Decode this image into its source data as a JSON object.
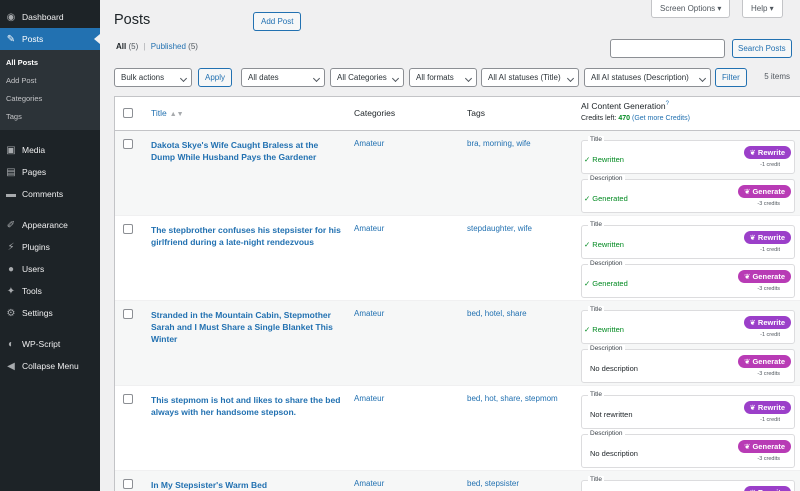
{
  "sidebar": {
    "items": [
      {
        "key": "dashboard",
        "label": "Dashboard",
        "icon": "dashboard-icon",
        "glyph": "◉"
      },
      {
        "key": "posts",
        "label": "Posts",
        "icon": "pin-icon",
        "glyph": "✎",
        "current": true
      },
      {
        "key": "media",
        "label": "Media",
        "icon": "media-icon",
        "glyph": "▣"
      },
      {
        "key": "pages",
        "label": "Pages",
        "icon": "pages-icon",
        "glyph": "▤"
      },
      {
        "key": "comments",
        "label": "Comments",
        "icon": "comment-icon",
        "glyph": "▬"
      },
      {
        "key": "appearance",
        "label": "Appearance",
        "icon": "brush-icon",
        "glyph": "✐"
      },
      {
        "key": "plugins",
        "label": "Plugins",
        "icon": "plug-icon",
        "glyph": "⚡"
      },
      {
        "key": "users",
        "label": "Users",
        "icon": "user-icon",
        "glyph": "●"
      },
      {
        "key": "tools",
        "label": "Tools",
        "icon": "wrench-icon",
        "glyph": "✦"
      },
      {
        "key": "settings",
        "label": "Settings",
        "icon": "settings-icon",
        "glyph": "⚙"
      },
      {
        "key": "wpscript",
        "label": "WP-Script",
        "icon": "wpscript-icon",
        "glyph": "◐"
      },
      {
        "key": "collapse",
        "label": "Collapse Menu",
        "icon": "collapse-icon",
        "glyph": "◀"
      }
    ],
    "submenu": [
      "All Posts",
      "Add Post",
      "Categories",
      "Tags"
    ]
  },
  "header": {
    "title": "Posts",
    "add_post": "Add Post",
    "screen_options": "Screen Options ▾",
    "help": "Help ▾"
  },
  "views": {
    "all": "All",
    "all_count": "(5)",
    "sep": "|",
    "published": "Published",
    "published_count": "(5)"
  },
  "search": {
    "placeholder": "",
    "button": "Search Posts"
  },
  "filters": {
    "bulk": "Bulk actions",
    "apply": "Apply",
    "dates": "All dates",
    "categories": "All Categories",
    "formats": "All formats",
    "ai_title": "All AI statuses (Title)",
    "ai_desc": "All AI statuses (Description)",
    "filter": "Filter",
    "items": "5 items"
  },
  "columns": {
    "title": "Title",
    "categories": "Categories",
    "tags": "Tags",
    "ai": "AI Content Generation",
    "ai_sup": "?",
    "credits_prefix": "Credits left:",
    "credits_value": "470",
    "credits_link": "(Get more Credits)"
  },
  "labels": {
    "title_box": "Title",
    "desc_box": "Description",
    "rewrite": "❦ Rewrite",
    "generate": "❦ Generate",
    "rewrite_credit": "-1 credit",
    "generate_credit": "-3 credits"
  },
  "posts": [
    {
      "title": "Dakota Skye's Wife Caught Braless at the Dump While Husband Pays the Gardener",
      "category": "Amateur",
      "tags": "bra, morning, wife",
      "title_status": "Rewritten",
      "title_ok": true,
      "desc_status": "Generated",
      "desc_ok": true
    },
    {
      "title": "The stepbrother confuses his stepsister for his girlfriend during a late-night rendezvous",
      "category": "Amateur",
      "tags": "stepdaughter, wife",
      "title_status": "Rewritten",
      "title_ok": true,
      "desc_status": "Generated",
      "desc_ok": true
    },
    {
      "title": "Stranded in the Mountain Cabin, Stepmother Sarah and I Must Share a Single Blanket This Winter",
      "category": "Amateur",
      "tags": "bed, hotel, share",
      "title_status": "Rewritten",
      "title_ok": true,
      "desc_status": "No description",
      "desc_ok": false
    },
    {
      "title": "This stepmom is hot and likes to share the bed always with her handsome stepson.",
      "category": "Amateur",
      "tags": "bed, hot, share, stepmom",
      "title_status": "Not rewritten",
      "title_ok": false,
      "desc_status": "No description",
      "desc_ok": false
    },
    {
      "title": "In My Stepsister's Warm Bed",
      "category": "Amateur",
      "tags": "bed, stepsister",
      "title_status": "",
      "title_ok": false,
      "desc_status": "",
      "desc_ok": false
    }
  ],
  "colors": {
    "sidebar": "#1d2327",
    "accent": "#2271b1",
    "ok": "#008a20",
    "rewrite": "#9b3fc9"
  }
}
